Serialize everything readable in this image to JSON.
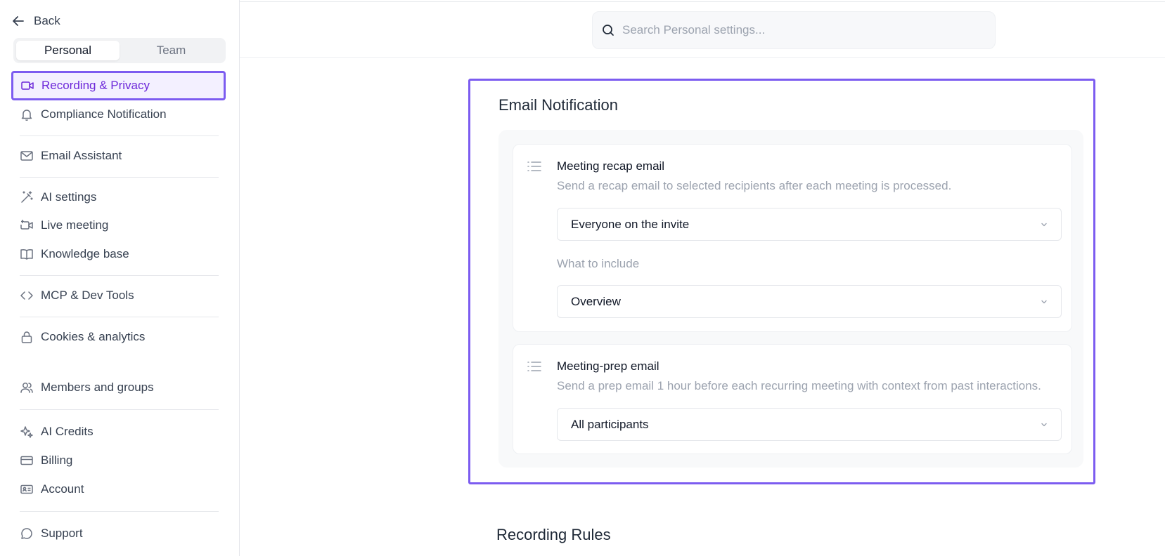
{
  "sidebar": {
    "back_label": "Back",
    "segments": [
      {
        "label": "Personal",
        "active": true
      },
      {
        "label": "Team",
        "active": false
      }
    ],
    "items": [
      {
        "label": "Recording & Privacy",
        "icon": "video-icon",
        "active": true
      },
      {
        "label": "Compliance Notification",
        "icon": "bell-icon"
      },
      {
        "label": "Email Assistant",
        "icon": "mail-icon"
      },
      {
        "label": "AI settings",
        "icon": "magic-wand-icon"
      },
      {
        "label": "Live meeting",
        "icon": "live-video-icon"
      },
      {
        "label": "Knowledge base",
        "icon": "book-icon"
      },
      {
        "label": "MCP & Dev Tools",
        "icon": "code-icon"
      },
      {
        "label": "Cookies & analytics",
        "icon": "lock-icon"
      },
      {
        "label": "Members and groups",
        "icon": "users-icon"
      },
      {
        "label": "AI Credits",
        "icon": "sparkle-icon"
      },
      {
        "label": "Billing",
        "icon": "credit-card-icon"
      },
      {
        "label": "Account",
        "icon": "id-card-icon"
      },
      {
        "label": "Support",
        "icon": "chat-icon"
      }
    ],
    "accent_color": "#7c5cf0"
  },
  "search": {
    "placeholder": "Search Personal settings..."
  },
  "email_notification": {
    "title": "Email Notification",
    "recap": {
      "title": "Meeting recap email",
      "description": "Send a recap email to selected recipients after each meeting is processed.",
      "recipients_value": "Everyone on the invite",
      "include_label": "What to include",
      "include_value": "Overview"
    },
    "prep": {
      "title": "Meeting-prep email",
      "description": "Send a prep email 1 hour before each recurring meeting with context from past interactions.",
      "recipients_value": "All participants"
    }
  },
  "recording_rules": {
    "title": "Recording Rules"
  }
}
